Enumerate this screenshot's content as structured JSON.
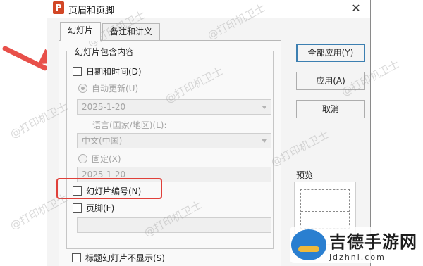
{
  "window": {
    "icon_letter": "P",
    "title": "页眉和页脚",
    "close_glyph": "✕"
  },
  "tabs": [
    {
      "label": "幻灯片",
      "active": true
    },
    {
      "label": "备注和讲义",
      "active": false
    }
  ],
  "group": {
    "label": "幻灯片包含内容",
    "datetime": {
      "label": "日期和时间(D)",
      "checked": false
    },
    "auto_update": {
      "label": "自动更新(U)",
      "selected": true,
      "value": "2025-1-20"
    },
    "language": {
      "label": "语言(国家/地区)(L):",
      "value": "中文(中国)"
    },
    "fixed": {
      "label": "固定(X)",
      "selected": false,
      "value": "2025-1-20"
    },
    "slide_number": {
      "label": "幻灯片编号(N)",
      "checked": false
    },
    "footer": {
      "label": "页脚(F)",
      "checked": false,
      "value": ""
    }
  },
  "title_slide_hide": {
    "label": "标题幻灯片不显示(S)",
    "checked": false
  },
  "buttons": {
    "apply_all": "全部应用(Y)",
    "apply": "应用(A)",
    "cancel": "取消"
  },
  "preview": {
    "label": "预览"
  },
  "watermark": {
    "text": "@打印机卫士"
  },
  "logo": {
    "cn": "吉德手游网",
    "en": "jdzhnl.com"
  },
  "colors": {
    "annotation": "#e8504a",
    "default_button_border": "#3c7fb1"
  }
}
